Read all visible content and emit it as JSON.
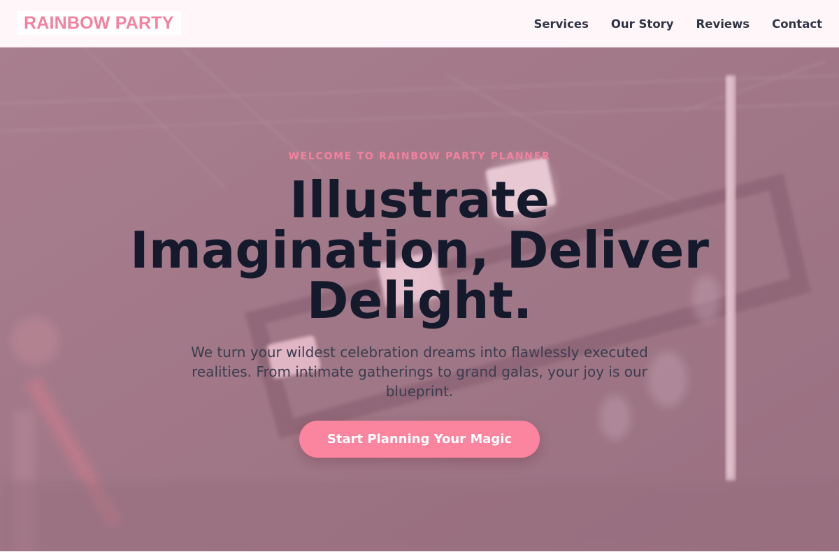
{
  "brand": {
    "name": "RAINBOW PARTY",
    "accent_color": "#f4819f"
  },
  "nav": {
    "items": [
      {
        "label": "Services"
      },
      {
        "label": "Our Story"
      },
      {
        "label": "Reviews"
      },
      {
        "label": "Contact"
      }
    ]
  },
  "hero": {
    "eyebrow": "WELCOME TO RAINBOW PARTY PLANNER",
    "headline": "Illustrate Imagination, Deliver Delight.",
    "subtext": "We turn your wildest celebration dreams into flawlessly executed realities. From intimate gatherings to grand galas, your joy is our blueprint.",
    "cta_label": "Start Planning Your Magic",
    "cta_color": "#fb849f",
    "background_tint": "#9b7583"
  }
}
